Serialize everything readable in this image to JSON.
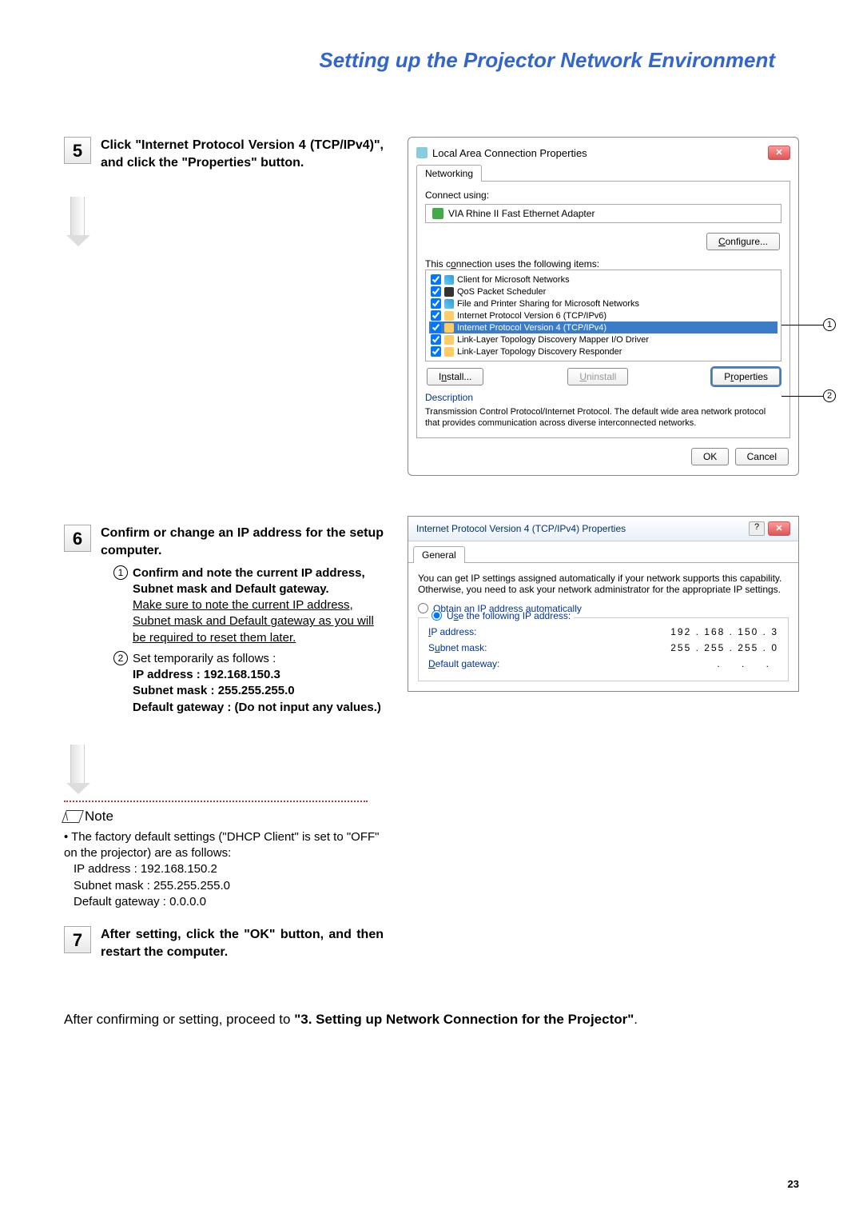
{
  "header": {
    "title": "Setting up the Projector Network Environment"
  },
  "step5": {
    "num": "5",
    "text": "Click \"Internet Protocol Version 4 (TCP/IPv4)\", and click the \"Properties\" button."
  },
  "step6": {
    "num": "6",
    "text": "Confirm or change an IP address for the setup computer.",
    "sub1_bold": "Confirm and note the current IP address, Subnet mask and Default gateway.",
    "sub1_body": "Make sure to note the current IP address, Subnet mask and Default gateway as you will be required to reset them later.",
    "sub2_lead": "Set  temporarily as follows :",
    "sub2_ip": "IP address : 192.168.150.3",
    "sub2_mask": "Subnet mask : 255.255.255.0",
    "sub2_gw": "Default gateway : (Do not input any values.)"
  },
  "note": {
    "label": "Note",
    "lines": [
      "• The factory default settings (\"DHCP Client\" is set to \"OFF\" on the projector) are as follows:",
      "IP address : 192.168.150.2",
      "Subnet mask : 255.255.255.0",
      "Default gateway : 0.0.0.0"
    ]
  },
  "step7": {
    "num": "7",
    "text": "After setting, click the \"OK\" button, and then restart the computer."
  },
  "bottom": {
    "lead": "After confirming or setting, proceed to ",
    "bold": "\"3. Setting up Network Connection for the Projector\"",
    "tail": "."
  },
  "page": "23",
  "dlg1": {
    "title": "Local Area Connection Properties",
    "tab": "Networking",
    "connect_using": "Connect using:",
    "adapter": "VIA Rhine II Fast Ethernet Adapter",
    "configure": "Configure...",
    "uses_label": "This connection uses the following items:",
    "items": [
      "Client for Microsoft Networks",
      "QoS Packet Scheduler",
      "File and Printer Sharing for Microsoft Networks",
      "Internet Protocol Version 6 (TCP/IPv6)",
      "Internet Protocol Version 4 (TCP/IPv4)",
      "Link-Layer Topology Discovery Mapper I/O Driver",
      "Link-Layer Topology Discovery Responder"
    ],
    "install": "Install...",
    "uninstall": "Uninstall",
    "properties": "Properties",
    "desc_label": "Description",
    "desc": "Transmission Control Protocol/Internet Protocol. The default wide area network protocol that provides communication across diverse interconnected networks.",
    "ok": "OK",
    "cancel": "Cancel"
  },
  "dlg2": {
    "title": "Internet Protocol Version 4 (TCP/IPv4) Properties",
    "tab": "General",
    "intro": "You can get IP settings assigned automatically if your network supports this capability. Otherwise, you need to ask your network administrator for the appropriate IP settings.",
    "radio_auto": "Obtain an IP address automatically",
    "radio_use": "Use the following IP address:",
    "ip_label": "IP address:",
    "ip_val": "192 . 168 . 150 .   3",
    "mask_label": "Subnet mask:",
    "mask_val": "255 . 255 . 255 .   0",
    "gw_label": "Default gateway:"
  },
  "callouts": {
    "c1": "1",
    "c2": "2"
  }
}
